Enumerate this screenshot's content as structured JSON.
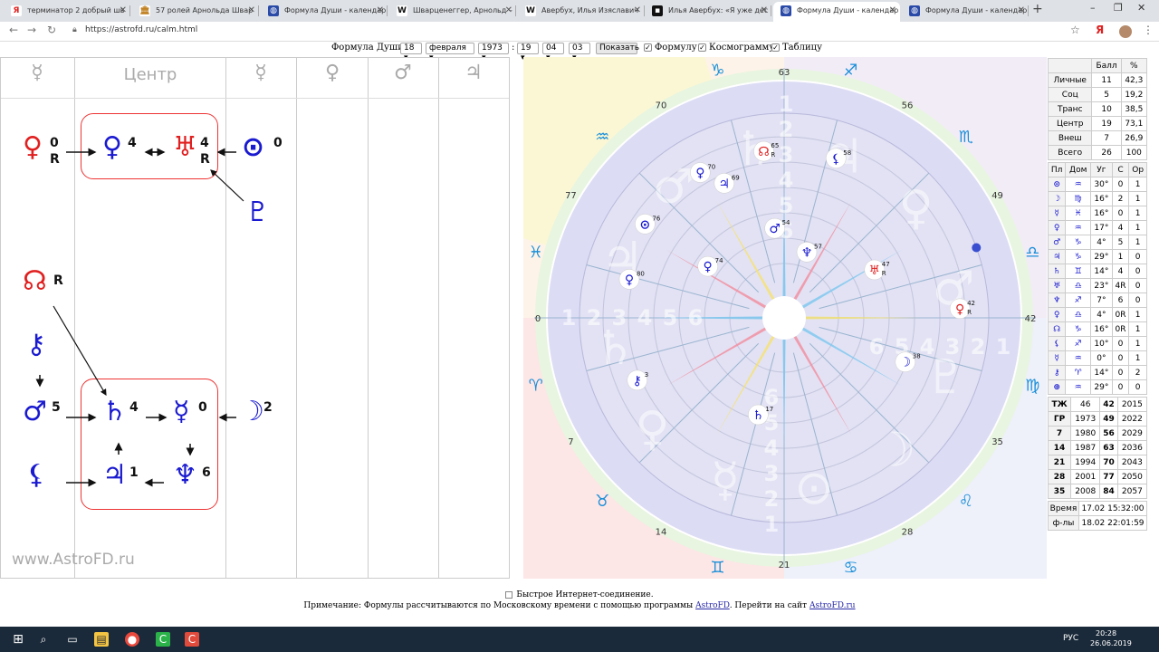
{
  "browser": {
    "tabs": [
      {
        "title": "терминатор 2 добрый шв",
        "icon": "yandex-icon",
        "active": false
      },
      {
        "title": "57 ролей Арнольда Швар",
        "icon": "pikabu-icon",
        "active": false
      },
      {
        "title": "Формула Души - календар",
        "icon": "astrofd-icon",
        "active": false
      },
      {
        "title": "Шварценеггер, Арнольд –",
        "icon": "wikipedia-icon",
        "active": false
      },
      {
        "title": "Авербух, Илья Изяславич",
        "icon": "wikipedia-icon",
        "active": false
      },
      {
        "title": "Илья Авербух: «Я уже дес",
        "icon": "news-icon",
        "active": false
      },
      {
        "title": "Формула Души - календар",
        "icon": "astrofd-icon",
        "active": true
      },
      {
        "title": "Формула Души - календар",
        "icon": "astrofd-icon",
        "active": false
      }
    ],
    "new_tab": "+",
    "url": "https://astrofd.ru/calm.html",
    "window_buttons": [
      "–",
      "❐",
      "✕"
    ]
  },
  "form": {
    "label": "Формула Души:",
    "day": "18",
    "month": "февраля",
    "year": "1973",
    "hour": "19",
    "minute": "04",
    "tz": "03",
    "colon": ":",
    "show_button": "Показать",
    "check_formula": "Формулу",
    "check_cosmogram": "Космограмму",
    "check_table": "Таблицу"
  },
  "diagram": {
    "headers": [
      "☿",
      "Центр",
      "☿",
      "♀",
      "♂",
      "♃"
    ],
    "center_label": "Центр",
    "nodes": [
      {
        "glyph": "♀",
        "num": "0",
        "sub": "R",
        "color": "#e02020"
      },
      {
        "glyph": "♀",
        "num": "4",
        "sub": "",
        "color": "#1a1ad0"
      },
      {
        "glyph": "♅",
        "num": "4",
        "sub": "R",
        "color": "#e02020"
      },
      {
        "glyph": "⊙",
        "num": "0",
        "sub": "",
        "color": "#1a1ad0"
      },
      {
        "glyph": "♇",
        "num": "",
        "sub": "",
        "color": "#1a1ad0"
      },
      {
        "glyph": "☊",
        "num": "",
        "sub": "R",
        "color": "#e02020"
      },
      {
        "glyph": "⚷",
        "num": "",
        "sub": "",
        "color": "#1a1ad0"
      },
      {
        "glyph": "♂",
        "num": "5",
        "sub": "",
        "color": "#1a1ad0"
      },
      {
        "glyph": "♄",
        "num": "4",
        "sub": "",
        "color": "#1a1ad0"
      },
      {
        "glyph": "☿",
        "num": "0",
        "sub": "",
        "color": "#1a1ad0"
      },
      {
        "glyph": "☽",
        "num": "2",
        "sub": "",
        "color": "#1a1ad0"
      },
      {
        "glyph": "⚸",
        "num": "",
        "sub": "",
        "color": "#1a1ad0"
      },
      {
        "glyph": "♃",
        "num": "1",
        "sub": "",
        "color": "#1a1ad0"
      },
      {
        "glyph": "♆",
        "num": "6",
        "sub": "",
        "color": "#1a1ad0"
      }
    ],
    "watermark": "www.AstroFD.ru"
  },
  "chart": {
    "degree_labels": [
      "63",
      "56",
      "49",
      "42",
      "35",
      "28",
      "21",
      "14",
      "7",
      "0",
      "77",
      "70"
    ],
    "signs": [
      "♑",
      "♐",
      "♏",
      "♎",
      "♍",
      "♌",
      "♋",
      "♊",
      "♉",
      "♈",
      "♓",
      "♒"
    ],
    "planets": [
      {
        "glyph": "☊",
        "num": "65",
        "sub": "R",
        "angle": 97,
        "r": 0.82,
        "color": "#e02020"
      },
      {
        "glyph": "⚸",
        "num": "58",
        "sub": "",
        "angle": 72,
        "r": 0.82,
        "color": "#1a1ad0"
      },
      {
        "glyph": "♀",
        "num": "70",
        "sub": "",
        "angle": 120,
        "r": 0.82,
        "color": "#1a1ad0"
      },
      {
        "glyph": "♃",
        "num": "69",
        "sub": "",
        "angle": 114,
        "r": 0.72,
        "color": "#1a1ad0"
      },
      {
        "glyph": "⊙",
        "num": "76",
        "sub": "",
        "angle": 146,
        "r": 0.82,
        "color": "#1a1ad0"
      },
      {
        "glyph": "♂",
        "num": "54",
        "sub": "",
        "angle": 96,
        "r": 0.44,
        "color": "#1a1ad0"
      },
      {
        "glyph": "♆",
        "num": "57",
        "sub": "",
        "angle": 71,
        "r": 0.34,
        "color": "#1a1ad0"
      },
      {
        "glyph": "♀",
        "num": "74",
        "sub": "",
        "angle": 146,
        "r": 0.45,
        "color": "#1a1ad0"
      },
      {
        "glyph": "♀",
        "num": "80",
        "sub": "",
        "angle": 166,
        "r": 0.78,
        "color": "#1a1ad0"
      },
      {
        "glyph": "♅",
        "num": "47",
        "sub": "R",
        "angle": 28,
        "r": 0.5,
        "color": "#e02020"
      },
      {
        "glyph": "♀",
        "num": "42",
        "sub": "R",
        "angle": 3,
        "r": 0.86,
        "color": "#e02020"
      },
      {
        "glyph": "☽",
        "num": "38",
        "sub": "",
        "angle": -20,
        "r": 0.63,
        "color": "#1a1ad0"
      },
      {
        "glyph": "⚷",
        "num": "3",
        "sub": "",
        "angle": 203,
        "r": 0.78,
        "color": "#1a1ad0"
      },
      {
        "glyph": "♄",
        "num": "17",
        "sub": "",
        "angle": 255,
        "r": 0.49,
        "color": "#1a1ad0"
      }
    ]
  },
  "table": {
    "header": [
      "",
      "Балл",
      "%"
    ],
    "score_rows": [
      [
        "Личные",
        "11",
        "42,3"
      ],
      [
        "Соц",
        "5",
        "19,2"
      ],
      [
        "Транс",
        "10",
        "38,5"
      ],
      [
        "Центр",
        "19",
        "73,1"
      ],
      [
        "Внеш",
        "7",
        "26,9"
      ],
      [
        "Всего",
        "26",
        "100"
      ]
    ],
    "planet_header": [
      "Пл",
      "Дом",
      "Уг",
      "С",
      "Ор"
    ],
    "planet_rows": [
      [
        "⊙",
        "♒",
        "30°",
        "0",
        "1"
      ],
      [
        "☽",
        "♍",
        "16°",
        "2",
        "1"
      ],
      [
        "☿",
        "♓",
        "16°",
        "0",
        "1"
      ],
      [
        "♀",
        "♒",
        "17°",
        "4",
        "1"
      ],
      [
        "♂",
        "♑",
        "4°",
        "5",
        "1"
      ],
      [
        "♃",
        "♑",
        "29°",
        "1",
        "0"
      ],
      [
        "♄",
        "♊",
        "14°",
        "4",
        "0"
      ],
      [
        "♅",
        "♎",
        "23°",
        "4R",
        "0"
      ],
      [
        "♆",
        "♐",
        "7°",
        "6",
        "0"
      ],
      [
        "♀",
        "♎",
        "4°",
        "0R",
        "1"
      ],
      [
        "☊",
        "♑",
        "16°",
        "0R",
        "1"
      ],
      [
        "⚸",
        "♐",
        "10°",
        "0",
        "1"
      ],
      [
        "☿",
        "♒",
        "0°",
        "0",
        "1"
      ],
      [
        "⚷",
        "♈",
        "14°",
        "0",
        "2"
      ],
      [
        "⊕",
        "♒",
        "29°",
        "0",
        "0"
      ]
    ],
    "year_rows": [
      [
        "ТЖ",
        "46",
        "42",
        "2015"
      ],
      [
        "ГР",
        "1973",
        "49",
        "2022"
      ],
      [
        "7",
        "1980",
        "56",
        "2029"
      ],
      [
        "14",
        "1987",
        "63",
        "2036"
      ],
      [
        "21",
        "1994",
        "70",
        "2043"
      ],
      [
        "28",
        "2001",
        "77",
        "2050"
      ],
      [
        "35",
        "2008",
        "84",
        "2057"
      ]
    ],
    "time_rows": [
      [
        "Время",
        "17.02 15:32:00"
      ],
      [
        "ф-лы",
        "18.02 22:01:59"
      ]
    ]
  },
  "footer": {
    "checkbox_label": "Быстрое Интернет-соединение.",
    "note_prefix": "Примечание: Формулы рассчитываются по Московскому времени с помощью программы",
    "link1": "AstroFD",
    "note_middle": ". Перейти на сайт",
    "link2": "AstroFD.ru"
  },
  "taskbar": {
    "time": "20:28",
    "date": "26.06.2019",
    "lang": "РУС",
    "search_glyph": "⌕"
  }
}
